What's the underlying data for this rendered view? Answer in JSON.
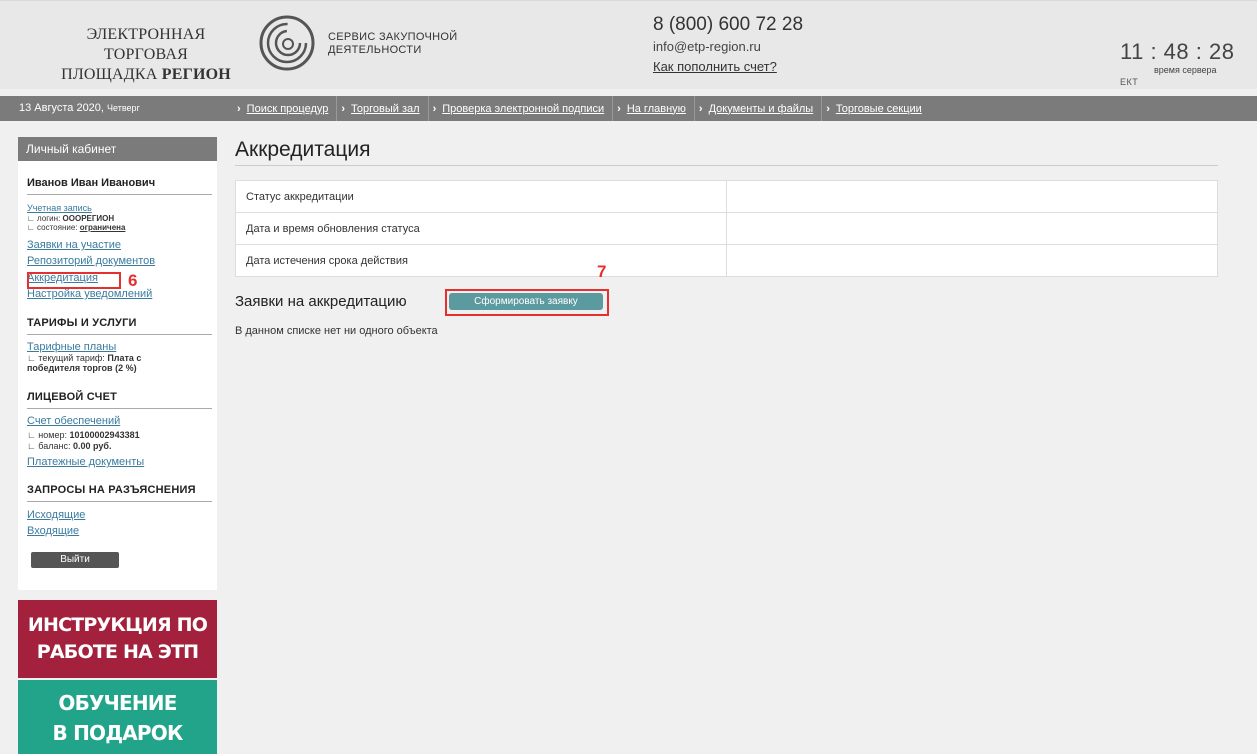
{
  "header": {
    "logo_line1": "ЭЛЕКТРОННАЯ ТОРГОВАЯ",
    "logo_line2_a": "ПЛОЩАДКА ",
    "logo_line2_b": "РЕГИОН",
    "service_line1": "СЕРВИС ЗАКУПОЧНОЙ",
    "service_line2": "ДЕЯТЕЛЬНОСТИ",
    "phone": "8 (800) 600 72 28",
    "email": "info@etp-region.ru",
    "topup_link": "Как пополнить счет?",
    "clock": "11 : 48 : 28",
    "timezone": "ЕКТ",
    "server_time_label": "время сервера"
  },
  "navbar": {
    "date": "13 Августа 2020,",
    "weekday": "Четверг",
    "links": [
      "Поиск процедур",
      "Торговый зал",
      "Проверка электронной подписи",
      "На главную",
      "Документы и файлы",
      "Торговые секции"
    ]
  },
  "sidebar": {
    "header": "Личный кабинет",
    "user_name": "Иванов Иван Иванович",
    "account_link": "Учетная запись",
    "login_label": "∟ логин:",
    "login_value": "ОООРЕГИОН",
    "state_label": "∟ состояние:",
    "state_value": "ограничена",
    "links_main": [
      "Заявки на участие",
      "Репозиторий документов",
      "Аккредитация",
      "Настройка уведомлений"
    ],
    "tariffs_title": "ТАРИФЫ И УСЛУГИ",
    "tariff_plans_link": "Тарифные планы",
    "tariff_current_label": "∟ текущий тариф:",
    "tariff_current_value_1": "Плата с",
    "tariff_current_value_2": "победителя торгов (2 %)",
    "account_title": "ЛИЦЕВОЙ СЧЕТ",
    "deposit_link": "Счет обеспечений",
    "number_label": "∟ номер:",
    "number_value": "10100002943381",
    "balance_label": "∟ баланс:",
    "balance_value": "0.00 руб.",
    "payment_docs_link": "Платежные документы",
    "requests_title": "ЗАПРОСЫ НА РАЗЪЯСНЕНИЯ",
    "outgoing_link": "Исходящие",
    "incoming_link": "Входящие",
    "logout": "Выйти"
  },
  "annotations": {
    "step6": "6",
    "step7": "7"
  },
  "banners": {
    "instruction_1": "ИНСТРУКЦИЯ ПО",
    "instruction_2": "РАБОТЕ НА ЭТП",
    "training_1": "ОБУЧЕНИЕ",
    "training_2": "В ПОДАРОК"
  },
  "main": {
    "title": "Аккредитация",
    "rows": [
      {
        "label": "Статус аккредитации",
        "value": ""
      },
      {
        "label": "Дата и время обновления статуса",
        "value": ""
      },
      {
        "label": "Дата истечения срока действия",
        "value": ""
      }
    ],
    "requests_title": "Заявки на аккредитацию",
    "form_button": "Сформировать заявку",
    "empty_message": "В данном списке нет ни одного объекта"
  },
  "colors": {
    "accent_red": "#e53030",
    "button_teal": "#5b9b9f",
    "banner_red": "#a3213c",
    "banner_green": "#22a48b"
  }
}
